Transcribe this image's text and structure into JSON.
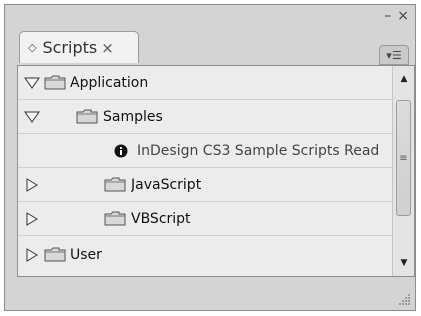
{
  "window": {
    "minimize_glyph": "–",
    "close_glyph": "×"
  },
  "tab": {
    "label": "Scripts",
    "close_glyph": "×"
  },
  "tree": {
    "items": [
      {
        "label": "Application",
        "expanded": true,
        "icon": "folder-icon"
      },
      {
        "label": "Samples",
        "expanded": true,
        "icon": "folder-icon"
      },
      {
        "label": "InDesign CS3 Sample Scripts Read",
        "icon": "info-icon"
      },
      {
        "label": "JavaScript",
        "expanded": false,
        "icon": "folder-icon"
      },
      {
        "label": "VBScript",
        "expanded": false,
        "icon": "folder-icon"
      },
      {
        "label": "User",
        "expanded": false,
        "icon": "folder-icon"
      }
    ]
  },
  "colors": {
    "panel_bg": "#d4d4d4",
    "list_bg": "#ececec",
    "folder_fill": "#d8d8d8",
    "folder_stroke": "#555555"
  }
}
